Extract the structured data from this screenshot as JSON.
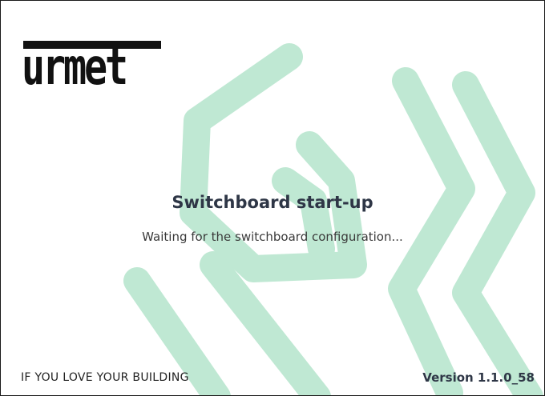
{
  "splash": {
    "logo_text": "urmet",
    "title": "Switchboard start-up",
    "status_message": "Waiting for the switchboard configuration...",
    "tagline": "IF YOU LOVE YOUR BUILDING",
    "version": "Version 1.1.0_58"
  },
  "colors": {
    "accent_shape": "#bfe8d3",
    "logo": "#111111",
    "title": "#2e3646",
    "border": "#1a1a1a"
  }
}
